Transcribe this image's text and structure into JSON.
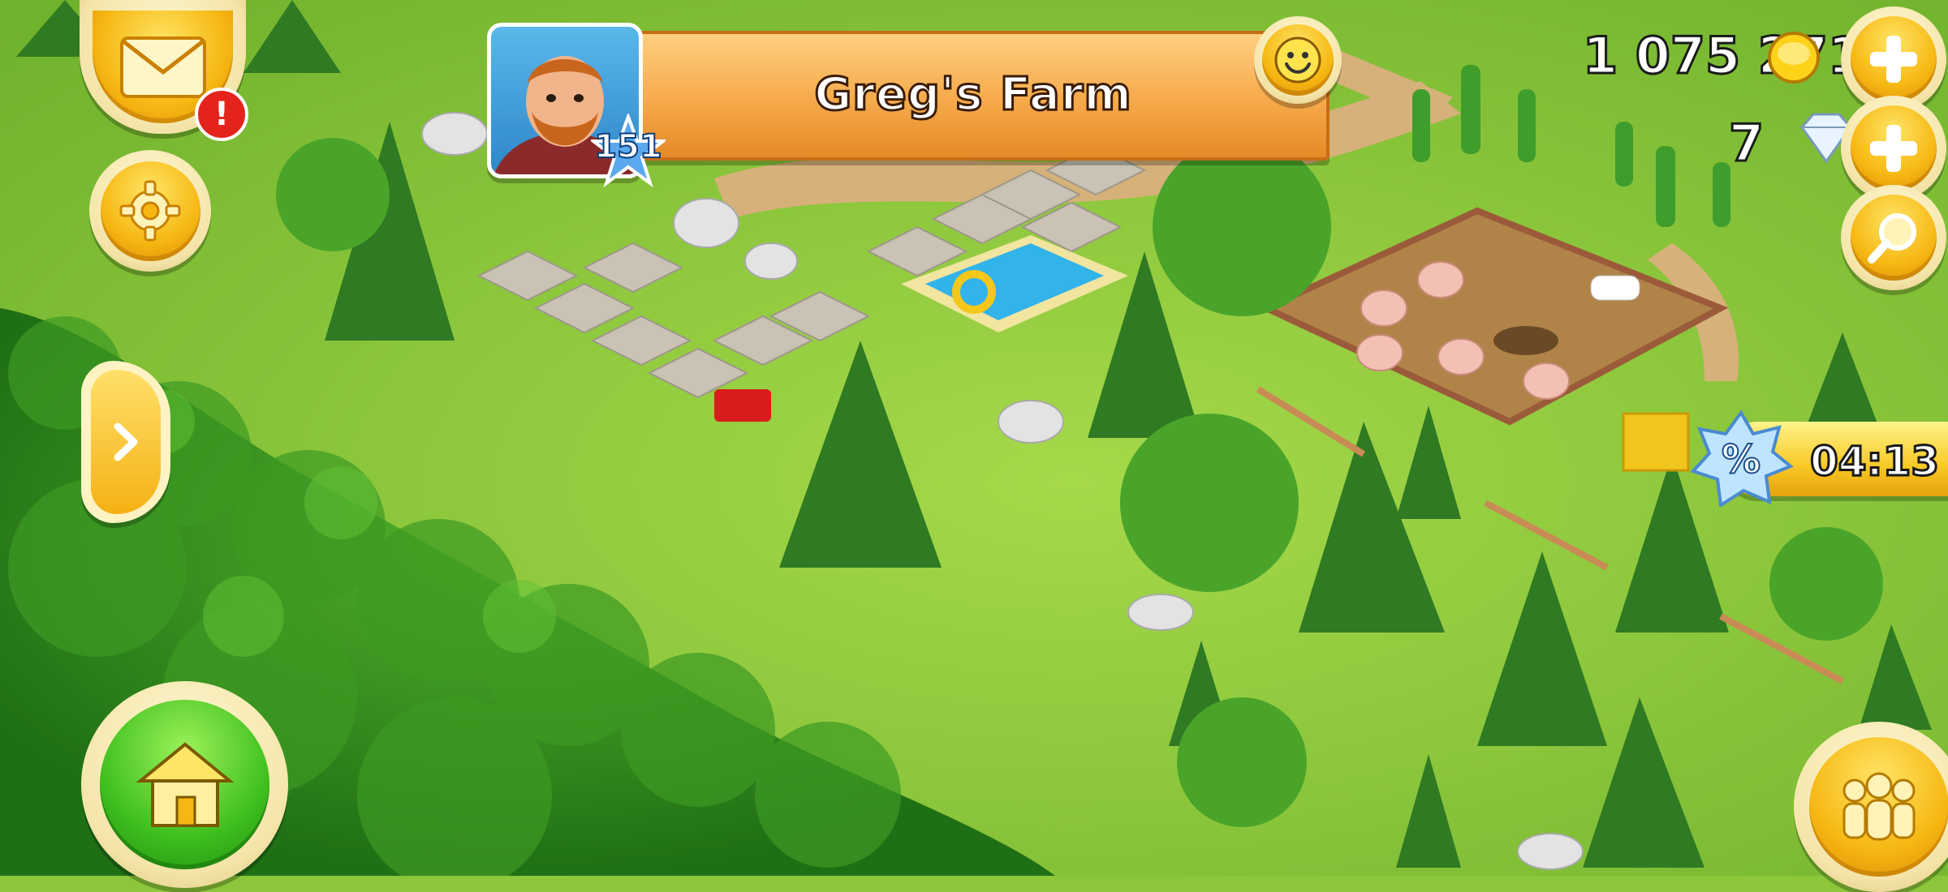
{
  "player": {
    "farm_name": "Greg's Farm",
    "level": "151"
  },
  "currency": {
    "coins": "1 075 271",
    "diamonds": "7"
  },
  "sale_offer": {
    "timer": "04:13"
  },
  "icons": {
    "mail": "envelope-icon",
    "alert": "exclamation-icon",
    "settings": "gear-icon",
    "expand": "chevron-right-icon",
    "home": "house-icon",
    "friends": "people-icon",
    "add": "plus-icon",
    "search": "magnifier-icon",
    "emote": "smiley-icon",
    "coin": "coin-icon",
    "diamond": "diamond-icon",
    "discount": "percent-badge-icon"
  },
  "colors": {
    "grass": "#8cc63a",
    "bush": "#2f8f1c",
    "banner": "#f6a94a",
    "button_gold": "#f6b712",
    "button_green": "#3fbf1e"
  }
}
